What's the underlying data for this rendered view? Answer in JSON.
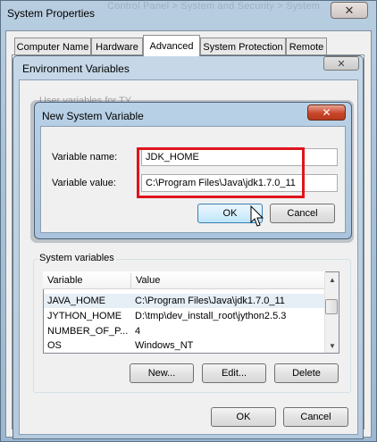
{
  "system_properties": {
    "title": "System Properties",
    "background_title": "Control Panel > System and Security > System",
    "tabs": [
      {
        "label": "Computer Name"
      },
      {
        "label": "Hardware"
      },
      {
        "label": "Advanced"
      },
      {
        "label": "System Protection"
      },
      {
        "label": "Remote"
      }
    ],
    "active_tab": "Advanced",
    "ok_label": "OK",
    "cancel_label": "Cancel"
  },
  "environment_variables": {
    "title": "Environment Variables",
    "user_vars_label": "User variables for TY",
    "system_vars_label": "System variables",
    "columns": [
      "Variable",
      "Value"
    ],
    "rows": [
      {
        "variable": "JAVA_HOME",
        "value": "C:\\Program Files\\Java\\jdk1.7.0_11",
        "selected": true
      },
      {
        "variable": "JYTHON_HOME",
        "value": "D:\\tmp\\dev_install_root\\jython2.5.3",
        "selected": false
      },
      {
        "variable": "NUMBER_OF_P...",
        "value": "4",
        "selected": false
      },
      {
        "variable": "OS",
        "value": "Windows_NT",
        "selected": false
      }
    ],
    "new_label": "New...",
    "edit_label": "Edit...",
    "delete_label": "Delete"
  },
  "new_system_variable": {
    "title": "New System Variable",
    "name_label": "Variable name:",
    "name_value": "JDK_HOME",
    "value_label": "Variable value:",
    "value_value": "C:\\Program Files\\Java\\jdk1.7.0_11",
    "ok_label": "OK",
    "cancel_label": "Cancel"
  },
  "icons": {
    "close": "close-icon",
    "scroll_up": "scroll-up-arrow-icon",
    "scroll_down": "scroll-down-arrow-icon",
    "cursor": "mouse-pointer-icon"
  },
  "colors": {
    "highlight_box": "#e0141b",
    "close_button_active": "#c8472b",
    "focus_button_border": "#3c7fb1"
  }
}
